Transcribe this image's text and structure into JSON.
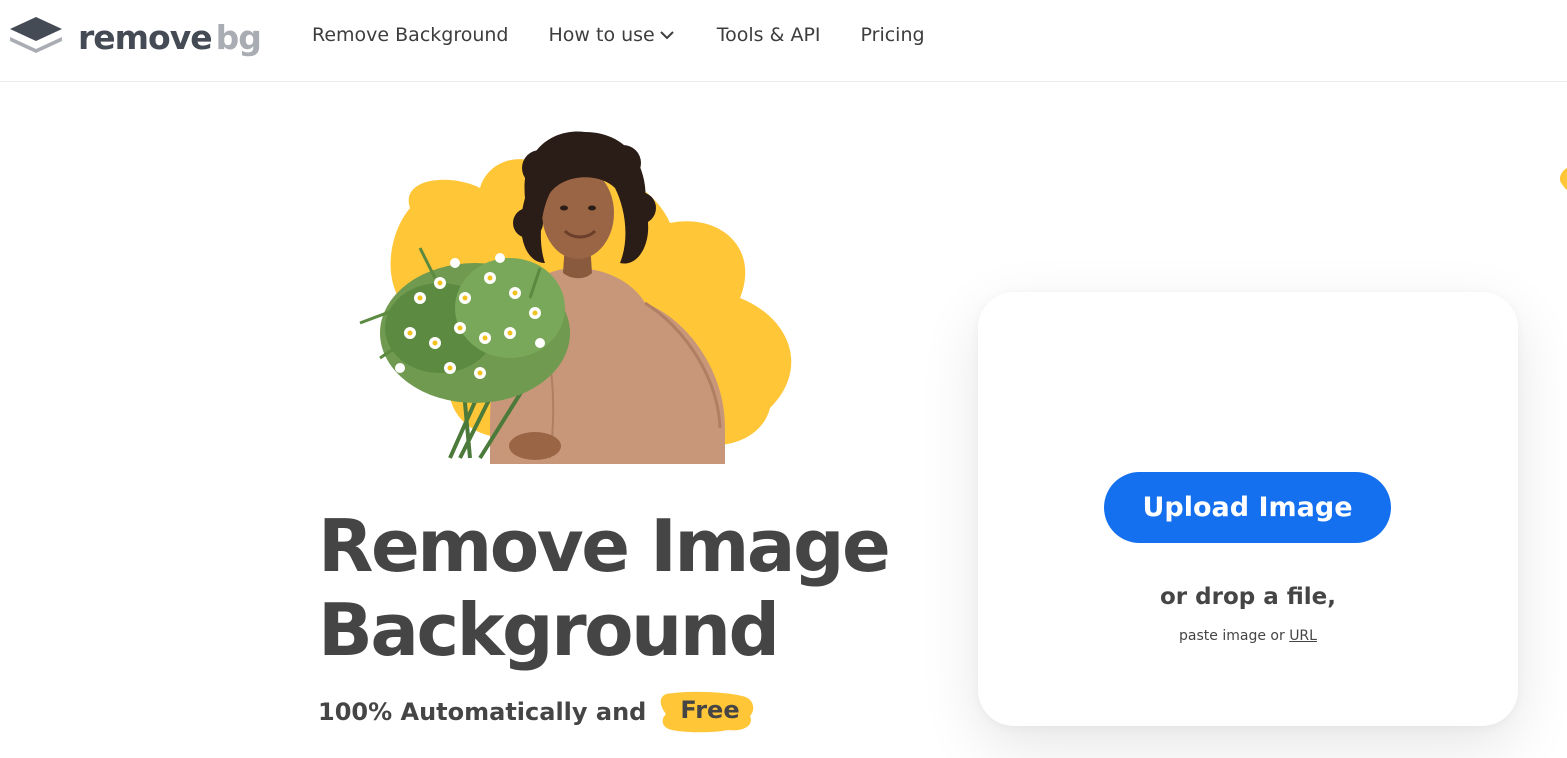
{
  "header": {
    "logo": {
      "text_main": "remove",
      "text_accent": "bg",
      "icon": "layers-icon"
    },
    "nav": [
      {
        "label": "Remove Background"
      },
      {
        "label": "How to use",
        "icon": "chevron-down-icon"
      },
      {
        "label": "Tools & API"
      },
      {
        "label": "Pricing"
      }
    ]
  },
  "hero": {
    "headline": "Remove Image Background",
    "subline": "100% Automatically and",
    "highlight": "Free"
  },
  "upload": {
    "button_label": "Upload Image",
    "drop_text": "or drop a file,",
    "paste_prefix": "paste image or",
    "url_link": "URL"
  },
  "colors": {
    "accent_blue": "#1570ef",
    "accent_yellow": "#ffc638",
    "text_dark": "#454545",
    "logo_dark": "#454b54",
    "logo_light": "#a9adb3"
  }
}
